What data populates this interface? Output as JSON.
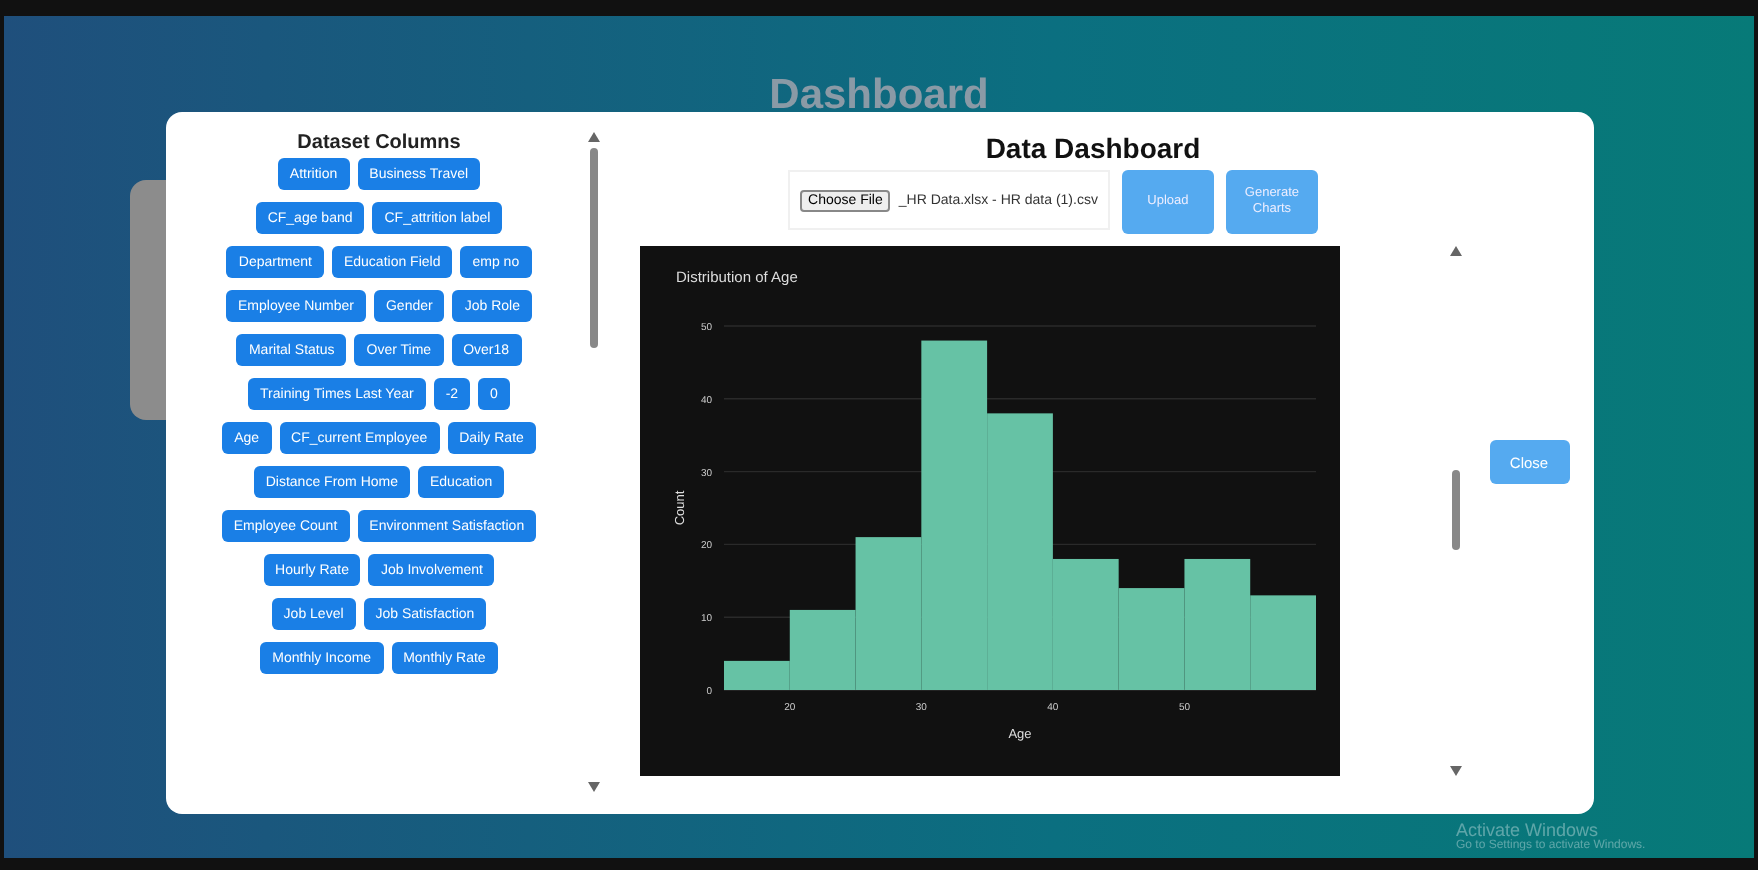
{
  "page": {
    "title": "Dashboard"
  },
  "sidebar": {
    "title": "Dataset Columns",
    "columns": [
      {
        "label": "Attrition"
      },
      {
        "label": "Business Travel"
      },
      {
        "label": "CF_age band"
      },
      {
        "label": "CF_attrition label"
      },
      {
        "label": "Department"
      },
      {
        "label": "Education Field"
      },
      {
        "label": "emp no"
      },
      {
        "label": "Employee Number"
      },
      {
        "label": "Gender"
      },
      {
        "label": "Job Role"
      },
      {
        "label": "Marital Status"
      },
      {
        "label": "Over Time"
      },
      {
        "label": "Over18"
      },
      {
        "label": "Training Times Last Year"
      },
      {
        "label": "-2"
      },
      {
        "label": "0"
      },
      {
        "label": "Age"
      },
      {
        "label": "CF_current Employee"
      },
      {
        "label": "Daily Rate"
      },
      {
        "label": "Distance From Home"
      },
      {
        "label": "Education"
      },
      {
        "label": "Employee Count"
      },
      {
        "label": "Environment Satisfaction"
      },
      {
        "label": "Hourly Rate"
      },
      {
        "label": "Job Involvement"
      },
      {
        "label": "Job Level"
      },
      {
        "label": "Job Satisfaction"
      },
      {
        "label": "Monthly Income"
      },
      {
        "label": "Monthly Rate"
      }
    ]
  },
  "dashboard": {
    "title": "Data Dashboard",
    "file_button": "Choose File",
    "file_name": "_HR Data.xlsx - HR data (1).csv",
    "upload_button": "Upload",
    "generate_button": "Generate Charts",
    "chart_data": {
      "type": "bar",
      "title": "Distribution of Age",
      "xlabel": "Age",
      "ylabel": "Count",
      "x": [
        17.5,
        22.5,
        27.5,
        32.5,
        37.5,
        42.5,
        47.5,
        52.5,
        57.5
      ],
      "values": [
        4,
        11,
        21,
        48,
        38,
        18,
        14,
        18,
        13
      ],
      "xlim": [
        15,
        60
      ],
      "ylim": [
        0,
        50
      ],
      "grid": true,
      "xticks": [
        20,
        30,
        40,
        50
      ],
      "yticks": [
        0,
        10,
        20,
        30,
        40,
        50
      ]
    }
  },
  "close_button": "Close",
  "watermark": {
    "line1": "Activate Windows",
    "line2": "Go to Settings to activate Windows."
  }
}
